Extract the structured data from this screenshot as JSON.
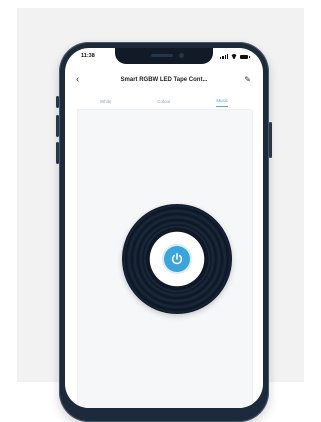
{
  "status_bar": {
    "time": "11:38"
  },
  "header": {
    "back_icon": "chevron-left-icon",
    "title": "Smart RGBW LED Tape Cont...",
    "edit_icon": "pencil-icon"
  },
  "tabs": [
    {
      "label": "White"
    },
    {
      "label": "Colour"
    },
    {
      "label": "Music",
      "active": true
    }
  ],
  "main": {
    "power_icon": "power-icon",
    "accent_color": "#3aa4db",
    "disc_color": "#0e1826"
  }
}
